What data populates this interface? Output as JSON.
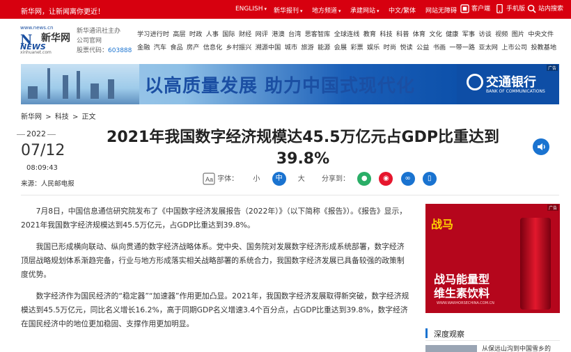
{
  "topbar": {
    "slogan": "新华网，让新闻离你更近！",
    "items": [
      {
        "label": "ENGLISH",
        "caret": true
      },
      {
        "label": "新华报刊",
        "caret": true
      },
      {
        "label": "地方频道",
        "caret": true
      },
      {
        "label": "承建网站",
        "caret": true
      },
      {
        "label": "中文/繁体",
        "caret": false
      },
      {
        "label": "网站无障碍",
        "caret": false
      },
      {
        "label": "客户端",
        "icon": "client-icon"
      },
      {
        "label": "手机版",
        "icon": "phone-icon"
      },
      {
        "label": "站内搜索",
        "icon": "search-icon"
      }
    ]
  },
  "logo": {
    "url": "www.news.cn",
    "name": "新华网",
    "news": "NEWS",
    "sub": "xinhuanet.com"
  },
  "site": {
    "line1": "新华通讯社主办",
    "line2": "公司官网",
    "stock_label": "股票代码：",
    "stock_code": "603888"
  },
  "nav": {
    "row1": [
      "学习进行时",
      "高层",
      "时政",
      "人事",
      "国际",
      "财经",
      "网评",
      "港澳",
      "台湾",
      "思客智库",
      "全球连线",
      "教育",
      "科技",
      "科普",
      "体育",
      "文化",
      "健康",
      "军事",
      "访谈",
      "视频",
      "图片",
      "中央文件"
    ],
    "row2": [
      "金融",
      "汽车",
      "食品",
      "房产",
      "信息化",
      "乡村振兴",
      "溯源中国",
      "城市",
      "旅游",
      "能源",
      "会展",
      "彩票",
      "娱乐",
      "时尚",
      "悦读",
      "公益",
      "书画",
      "一带一路",
      "亚太网",
      "上市公司",
      "投教基地"
    ]
  },
  "banner": {
    "slogan": "以高质量发展  助力中国式现代化",
    "bank_name": "交通银行",
    "bank_en": "BANK OF COMMUNICATIONS",
    "ad_tag": "广告"
  },
  "breadcrumb": [
    "新华网",
    ">",
    "科技",
    ">",
    "正文"
  ],
  "article_meta": {
    "year": "2022",
    "month_day": "07/12",
    "time": "08:09:43",
    "source": "来源：人民邮电报"
  },
  "article": {
    "title": "2021年我国数字经济规模达45.5万亿元占GDP比重达到39.8%",
    "paragraphs": [
      "7月8日，中国信息通信研究院发布了《中国数字经济发展报告（2022年）》（以下简称《报告》）。《报告》显示，2021年我国数字经济规模达到45.5万亿元，占GDP比重达到39.8%。",
      "我国已形成横向联动、纵向贯通的数字经济战略体系。党中央、国务院对发展数字经济形成系统部署，数字经济顶层战略规划体系渐趋完备，行业与地方形成落实相关战略部署的系统合力，我国数字经济发展已具备较强的政策制度优势。",
      "数字经济作为国民经济的“稳定器”“加速器”作用更加凸显。2021年，我国数字经济发展取得新突破，数字经济规模达到45.5万亿元，同比名义增长16.2%，高于同期GDP名义增速3.4个百分点，占GDP比重达到39.8%，数字经济在国民经济中的地位更加稳固、支撑作用更加明显。"
    ]
  },
  "fontbar": {
    "label": "字体：",
    "small": "小",
    "medium": "中",
    "large": "大"
  },
  "share": {
    "label": "分享到："
  },
  "ad2": {
    "brand": "战马",
    "line1": "战马能量型",
    "line2": "维生素饮料",
    "url": "WWW.WARHORSECHINA.COM.CN",
    "ad_tag": "广告"
  },
  "deep": {
    "title": "深度观察",
    "item": "从保远山沟到中国雪乡的"
  },
  "colors": {
    "accent_red": "#d7000f",
    "accent_blue": "#1a73d0"
  }
}
